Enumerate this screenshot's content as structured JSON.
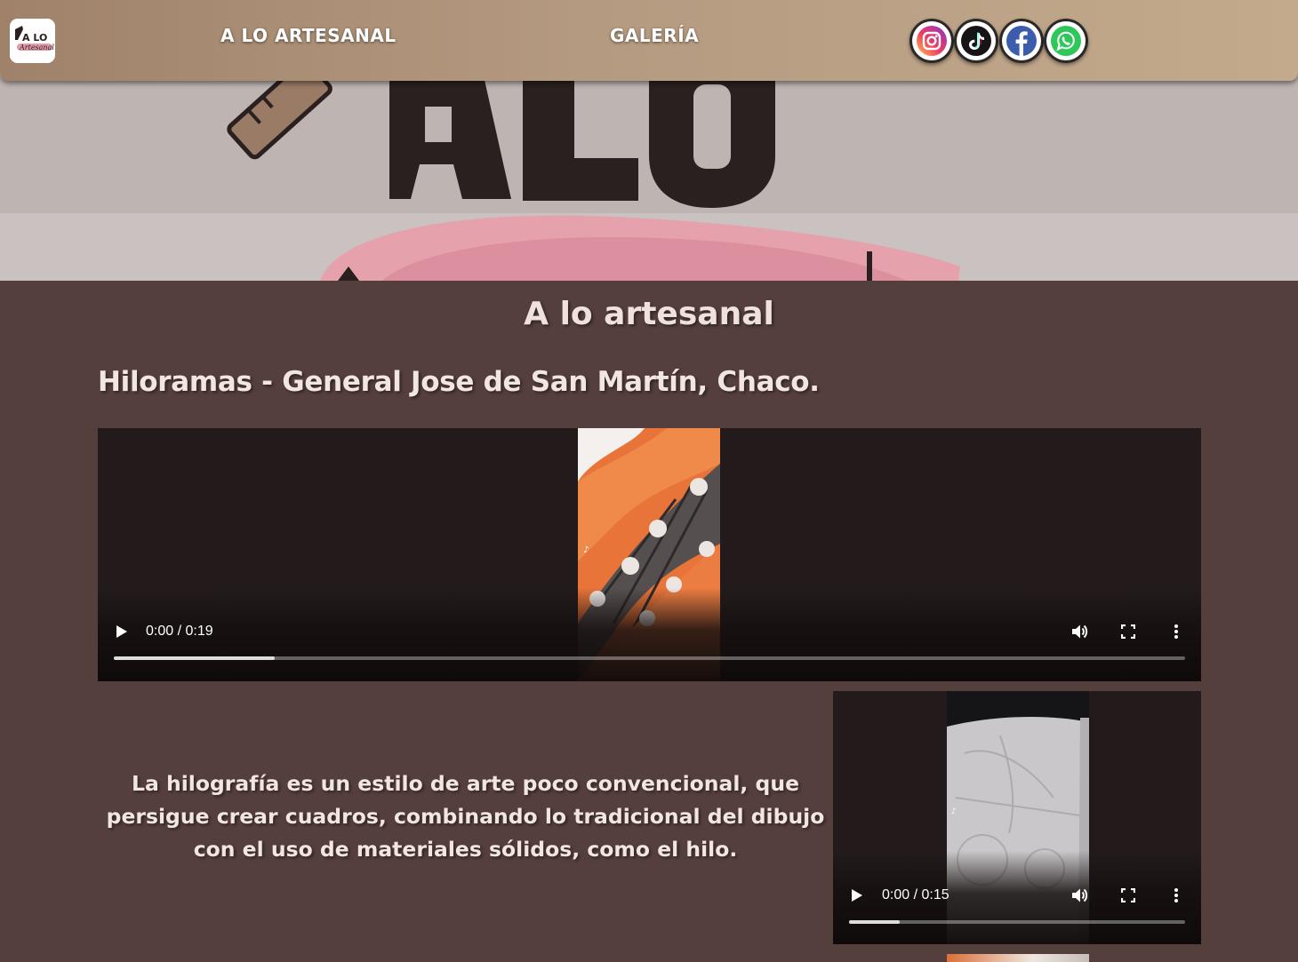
{
  "header": {
    "logo_text": "A LO Artesanal",
    "nav": [
      {
        "label": "A LO ARTESANAL"
      },
      {
        "label": "GALERÍA"
      }
    ],
    "social": [
      {
        "icon": "instagram-icon"
      },
      {
        "icon": "tiktok-icon"
      },
      {
        "icon": "facebook-icon"
      },
      {
        "icon": "whatsapp-icon"
      }
    ]
  },
  "hero": {
    "text": "A LO"
  },
  "main": {
    "title": "A lo artesanal",
    "subtitle": "Hiloramas - General Jose de San Martín, Chaco.",
    "paragraph": "La hilografía es un estilo de arte poco convencional, que persigue crear cuadros, combinando lo tradicional del dibujo con el uso de materiales sólidos, como el hilo."
  },
  "videos": [
    {
      "time": "0:00 / 0:19",
      "progress": 0.15
    },
    {
      "time": "0:00 / 0:15",
      "progress": 0.15
    }
  ],
  "colors": {
    "background": "#553f3d",
    "header_start": "#a0826b",
    "header_end": "#c4aa8c",
    "text_light": "#f2e6e1"
  }
}
